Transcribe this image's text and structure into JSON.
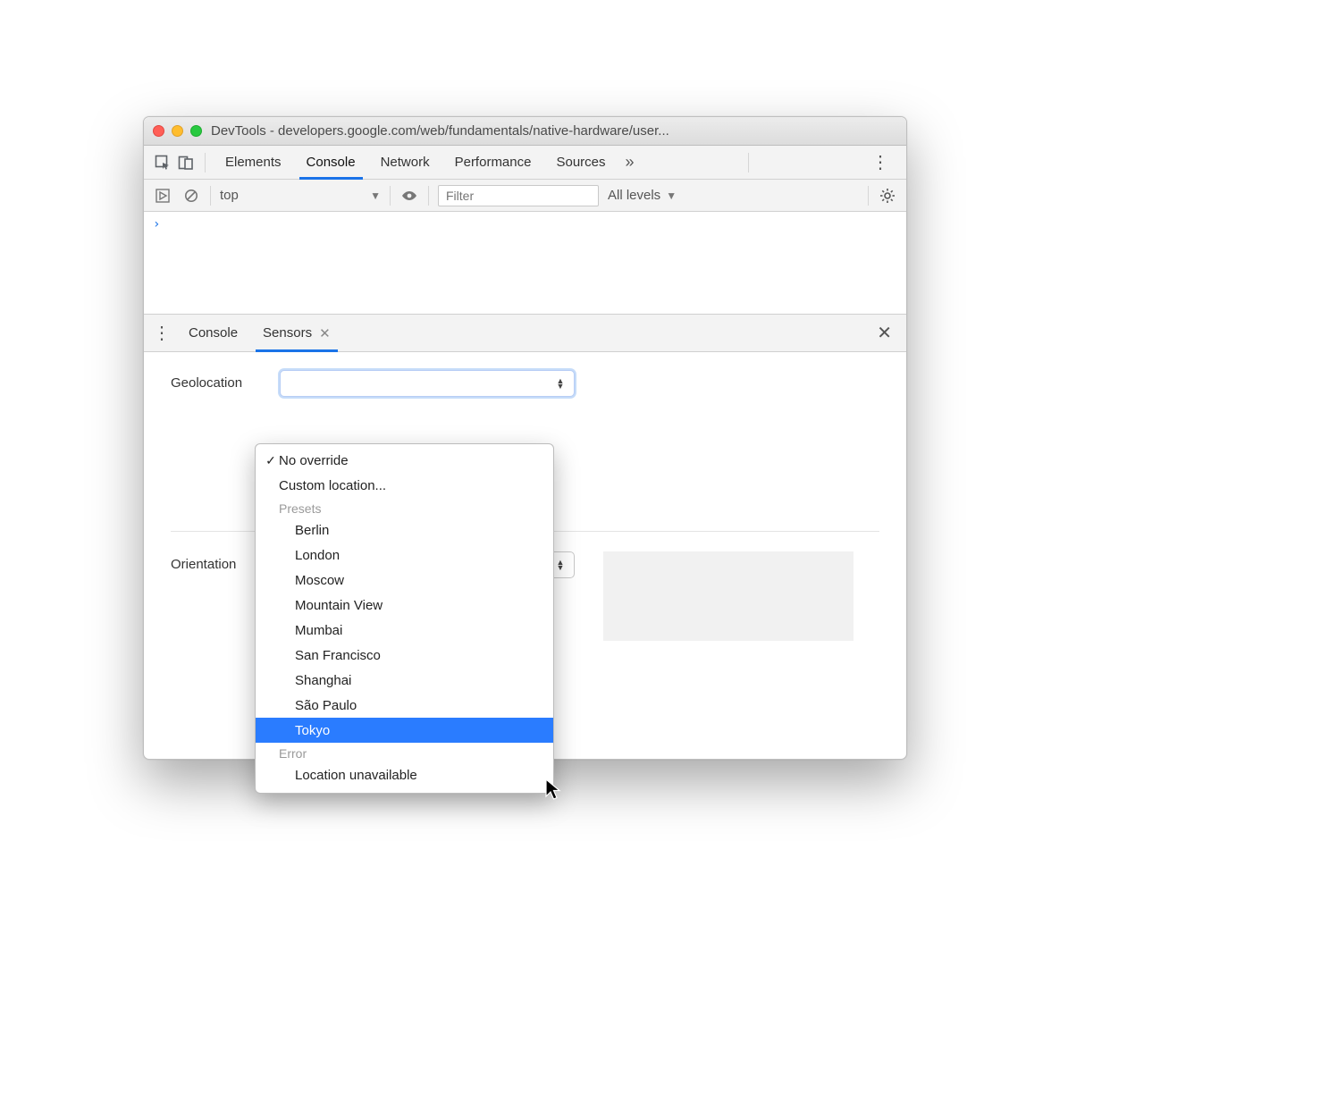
{
  "titlebar": {
    "title": "DevTools - developers.google.com/web/fundamentals/native-hardware/user..."
  },
  "tabs": {
    "items": [
      "Elements",
      "Console",
      "Network",
      "Performance",
      "Sources"
    ],
    "active_index": 1
  },
  "console_toolbar": {
    "context": "top",
    "filter_placeholder": "Filter",
    "levels": "All levels"
  },
  "console": {
    "prompt": "›"
  },
  "drawer": {
    "tabs": [
      "Console",
      "Sensors"
    ],
    "active_index": 1
  },
  "sensors": {
    "geolocation_label": "Geolocation",
    "orientation_label": "Orientation"
  },
  "geo_dropdown": {
    "no_override": "No override",
    "custom": "Custom location...",
    "presets_header": "Presets",
    "presets": [
      "Berlin",
      "London",
      "Moscow",
      "Mountain View",
      "Mumbai",
      "San Francisco",
      "Shanghai",
      "São Paulo",
      "Tokyo"
    ],
    "highlighted": "Tokyo",
    "error_header": "Error",
    "error_item": "Location unavailable"
  }
}
